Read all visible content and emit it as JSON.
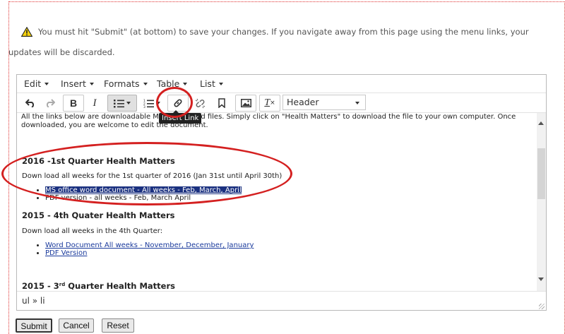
{
  "warning": {
    "text": "You must hit \"Submit\" (at bottom) to save your changes. If you navigate away from this page using the menu links, your updates will be discarded.",
    "icon": "warning-icon"
  },
  "editor": {
    "menubar": [
      "Edit",
      "Insert",
      "Formats",
      "Table",
      "List"
    ],
    "toolbar": {
      "undo_icon": "undo-icon",
      "redo_icon": "redo-icon",
      "bold": "B",
      "italic": "I",
      "bullet_list_icon": "bullet-list-icon",
      "numbered_list_icon": "numbered-list-icon",
      "insert_link_icon": "link-icon",
      "remove_link_icon": "unlink-icon",
      "bookmark_icon": "bookmark-icon",
      "image_icon": "image-icon",
      "clear_format": "T",
      "block_format": "Header"
    },
    "tooltip": "Insert Link",
    "content": {
      "intro": "All the links below are downloadable Microsoft Word files. Simply click on \"Health Matters\" to download the file to your own computer. Once downloaded, you are welcome to edit the document.",
      "sections": [
        {
          "title": "2016 -1st Quarter Health Matters",
          "text": "Down load all weeks for the 1st quarter of 2016 (Jan 31st until April 30th)",
          "items": [
            "MS office word document - All weeks - Feb, March, April",
            "PDF version - all weeks - Feb, March April"
          ]
        },
        {
          "title": "2015 - 4th Quater Health Matters",
          "text": "Down load all weeks in the 4th Quarter:",
          "items": [
            "Word Document All weeks - November, December, January",
            "PDF Version"
          ]
        },
        {
          "title_a": "2015 - 3",
          "title_sup": "rd",
          "title_b": " Quarter Health Matters"
        }
      ]
    },
    "statusbar": "ul » li"
  },
  "buttons": {
    "submit": "Submit",
    "cancel": "Cancel",
    "reset": "Reset"
  },
  "colors": {
    "annotation": "#d42020",
    "selection": "#1b3180",
    "link": "#1a3a9c"
  }
}
